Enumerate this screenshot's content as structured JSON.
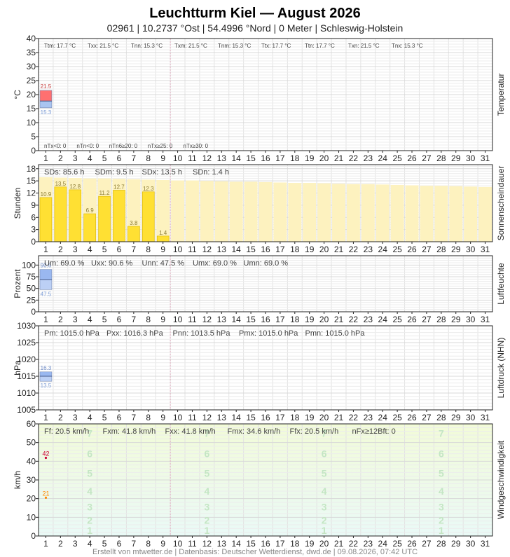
{
  "header": {
    "title": "Leuchtturm Kiel  —  August 2026",
    "subtitle": "02961  |  10.2737 °Ost  |  54.4996 °Nord  |  0 Meter  |  Schleswig-Holstein"
  },
  "footer": "Erstellt von mtwetter.de | Datenbasis: Deutscher Wetterdienst, dwd.de | 09.08.2026, 07:42 UTC",
  "colors": {
    "temp_max": "#ff7070",
    "temp_min": "#a9c4f0",
    "sun_bar": "#ffe033",
    "sun_possible": "#fdf2bf",
    "humidity_max": "#9ab8f0",
    "humidity_min": "#bcd0f5",
    "pressure_max": "#9ab8f0",
    "pressure_min": "#bcd0f5",
    "wind_bg_top": "#f2fbd8",
    "wind_bg_bottom": "#eafaf7",
    "wind_max": "#cc0033",
    "wind_mean": "#ff8800"
  },
  "chart_data": [
    {
      "id": "temperature",
      "type": "bar",
      "ylabel": "°C",
      "side_label": "Temperatur",
      "ylim": [
        0,
        40
      ],
      "yticks": [
        0,
        5,
        10,
        15,
        20,
        25,
        30,
        35,
        40
      ],
      "x": [
        1,
        2,
        3,
        4,
        5,
        6,
        7,
        8,
        9,
        10,
        11,
        12,
        13,
        14,
        15,
        16,
        17,
        18,
        19,
        20,
        21,
        22,
        23,
        24,
        25,
        26,
        27,
        28,
        29,
        30,
        31
      ],
      "series": [
        {
          "name": "Tx",
          "day": 1,
          "value": 21.5
        },
        {
          "name": "Tm",
          "day": 1,
          "value": 17.7
        },
        {
          "name": "Tn",
          "day": 1,
          "value": 15.3
        }
      ],
      "data_labels": {
        "max": "21.5",
        "min": "15.3"
      },
      "stats_top": [
        "Ttm: 17.7 °C",
        "Txx: 21.5 °C",
        "Tnn: 15.3 °C",
        "Txm: 21.5 °C",
        "Tnm: 15.3 °C",
        "Ttx: 17.7 °C",
        "Ttn: 17.7 °C",
        "Txn: 21.5 °C",
        "Tnx: 15.3 °C"
      ],
      "stats_bottom": [
        "nTx<0: 0",
        "nTn<0: 0",
        "nTn6≥20: 0",
        "nTx≥25: 0",
        "nTx≥30: 0"
      ],
      "grid": true
    },
    {
      "id": "sunshine",
      "type": "bar",
      "ylabel": "Stunden",
      "side_label": "Sonnenscheindauer",
      "ylim": [
        0,
        19
      ],
      "yticks": [
        0,
        3,
        6,
        9,
        12,
        15,
        18
      ],
      "x": [
        1,
        2,
        3,
        4,
        5,
        6,
        7,
        8,
        9,
        10,
        11,
        12,
        13,
        14,
        15,
        16,
        17,
        18,
        19,
        20,
        21,
        22,
        23,
        24,
        25,
        26,
        27,
        28,
        29,
        30,
        31
      ],
      "values": [
        10.9,
        13.5,
        12.8,
        6.9,
        11.2,
        12.7,
        3.8,
        12.3,
        1.4
      ],
      "labels": [
        "10.9",
        "13.5",
        "12.8",
        "6.9",
        "11.2",
        "12.7",
        "3.8",
        "12.3",
        "1.4"
      ],
      "possible": [
        15.9,
        15.8,
        15.7,
        15.6,
        15.6,
        15.5,
        15.4,
        15.3,
        15.2,
        15.1,
        15.1,
        15.0,
        14.9,
        14.8,
        14.8,
        14.7,
        14.6,
        14.5,
        14.5,
        14.4,
        14.3,
        14.2,
        14.2,
        14.1,
        14.0,
        13.9,
        13.8,
        13.8,
        13.7,
        13.6,
        13.5
      ],
      "stats_top": [
        "SDs: 85.6 h",
        "SDm: 9.5 h",
        "SDx: 13.5 h",
        "SDn: 1.4 h"
      ],
      "grid": true
    },
    {
      "id": "humidity",
      "type": "bar",
      "ylabel": "Prozent",
      "side_label": "Luftfeuchte",
      "ylim": [
        0,
        120
      ],
      "yticks": [
        0,
        25,
        50,
        75,
        100
      ],
      "x": [
        1,
        2,
        3,
        4,
        5,
        6,
        7,
        8,
        9,
        10,
        11,
        12,
        13,
        14,
        15,
        16,
        17,
        18,
        19,
        20,
        21,
        22,
        23,
        24,
        25,
        26,
        27,
        28,
        29,
        30,
        31
      ],
      "series": [
        {
          "name": "Ux",
          "day": 1,
          "value": 90.6
        },
        {
          "name": "Um",
          "day": 1,
          "value": 69.0
        },
        {
          "name": "Un",
          "day": 1,
          "value": 47.5
        }
      ],
      "data_labels": {
        "max": "90.6",
        "min": "47.5"
      },
      "stats_top": [
        "Um: 69.0 %",
        "Uxx: 90.6 %",
        "Unn: 47.5 %",
        "Umx: 69.0 %",
        "Umn: 69.0 %"
      ],
      "grid": true
    },
    {
      "id": "pressure",
      "type": "bar",
      "ylabel": "hPa",
      "side_label": "Luftdruck (NHN)",
      "ylim": [
        1005,
        1030
      ],
      "yticks": [
        1005,
        1010,
        1015,
        1020,
        1025,
        1030
      ],
      "x": [
        1,
        2,
        3,
        4,
        5,
        6,
        7,
        8,
        9,
        10,
        11,
        12,
        13,
        14,
        15,
        16,
        17,
        18,
        19,
        20,
        21,
        22,
        23,
        24,
        25,
        26,
        27,
        28,
        29,
        30,
        31
      ],
      "series": [
        {
          "name": "Px",
          "day": 1,
          "value": 1016.3
        },
        {
          "name": "Pm",
          "day": 1,
          "value": 1015.0
        },
        {
          "name": "Pn",
          "day": 1,
          "value": 1013.5
        }
      ],
      "data_labels": {
        "max": "16.3",
        "min": "13.5"
      },
      "stats_top": [
        "Pm: 1015.0 hPa",
        "Pxx: 1016.3 hPa",
        "Pnn: 1013.5 hPa",
        "Pmx: 1015.0 hPa",
        "Pmn: 1015.0 hPa"
      ],
      "grid": true
    },
    {
      "id": "wind",
      "type": "scatter",
      "ylabel": "km/h",
      "side_label": "Windgeschwindigkeit",
      "ylim": [
        0,
        60
      ],
      "yticks": [
        0,
        10,
        20,
        30,
        40,
        50,
        60
      ],
      "x": [
        1,
        2,
        3,
        4,
        5,
        6,
        7,
        8,
        9,
        10,
        11,
        12,
        13,
        14,
        15,
        16,
        17,
        18,
        19,
        20,
        21,
        22,
        23,
        24,
        25,
        26,
        27,
        28,
        29,
        30,
        31
      ],
      "series": [
        {
          "name": "Fx",
          "day": 1,
          "value": 41.8,
          "label": "42"
        },
        {
          "name": "Fm",
          "day": 1,
          "value": 20.5,
          "label": "21"
        }
      ],
      "beaufort_marks": [
        {
          "label": "1",
          "value": 3
        },
        {
          "label": "2",
          "value": 8.5
        },
        {
          "label": "3",
          "value": 15.5
        },
        {
          "label": "4",
          "value": 24
        },
        {
          "label": "5",
          "value": 33.5
        },
        {
          "label": "6",
          "value": 44
        },
        {
          "label": "7",
          "value": 55
        }
      ],
      "beaufort_columns": [
        4,
        12,
        20,
        28
      ],
      "stats_top": [
        "Ff: 20.5 km/h",
        "Fxm: 41.8 km/h",
        "Fxx: 41.8 km/h",
        "Fmx: 34.6 km/h",
        "Ffx: 20.5 km/h",
        "nFx≥12Bft: 0"
      ],
      "grid": true
    }
  ]
}
